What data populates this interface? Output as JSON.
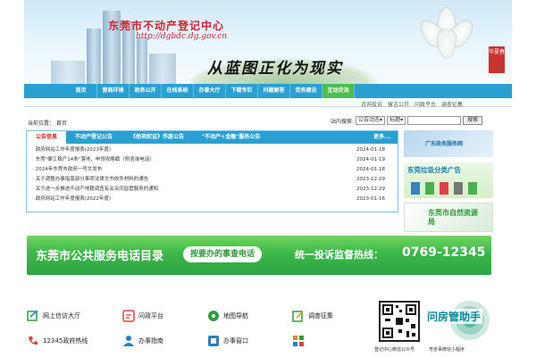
{
  "header": {
    "site_title": "东莞市不动产登记中心",
    "site_url": "http://dgbdc.dg.gov.cn",
    "slogan": "从蓝图正化为现实",
    "seal_text": "华夏春"
  },
  "nav": {
    "items": [
      "首页",
      "营商环境",
      "政务公开",
      "在线系统",
      "办事大厅",
      "下载专栏",
      "问题解答",
      "党务建设",
      "互动交流"
    ]
  },
  "subnav": {
    "links": [
      "咨询投诉",
      "留言公开",
      "问政平台",
      "调查征集"
    ]
  },
  "location": {
    "label": "当前位置：",
    "value": "首页"
  },
  "site_search": {
    "label": "站内搜索:",
    "scope_select": "公告动态",
    "field_select": "标题",
    "button": "搜索"
  },
  "announcements": {
    "tabs": [
      "公告信息",
      "不动产登记公告",
      "《他项权证》作废公告",
      "\"不动产+金融\"服务公告"
    ],
    "more": "更多...",
    "rows": [
      {
        "title": "政府网站工作年度报表(2023年度)",
        "date": "2024-01-18"
      },
      {
        "title": "东莞\"硬工稳产14条\"落地，申领攻略戳（附咨询电话）",
        "date": "2024-01-19"
      },
      {
        "title": "2024年东莞市政府一号文发布",
        "date": "2024-01-18"
      },
      {
        "title": "关于调整办事指南部分事项法律文书依件材料的通告",
        "date": "2023-12-29"
      },
      {
        "title": "关于进一步推进不动产地籍调查有关合同监管服务的通知",
        "date": "2023-12-29"
      },
      {
        "title": "政府网站工作年度报表(2022年度)",
        "date": "2023-01-16"
      }
    ]
  },
  "side_banners": {
    "gov_service": "广东政务服务网",
    "garbage": "东莞垃圾分类广告",
    "resource": "东莞市自然资源局"
  },
  "hotline": {
    "directory": "东莞市公共服务电话目录",
    "tag": "按要办的事查电话",
    "complaint_label": "统一投诉监督热线：",
    "number": "0769-12345"
  },
  "quick_links": {
    "row1": [
      "网上信访大厅",
      "问政平台",
      "地图导航",
      "调查征集"
    ],
    "row2": [
      "12345政府热线",
      "办事指南",
      "办事窗口"
    ]
  },
  "qr": {
    "wechat_label": "登记中心微信公众号",
    "mini_title": "问房管助手",
    "mini_label": "粤省事微信小程序"
  },
  "colors": {
    "nav_blue": "#2a9fd2",
    "title_red": "#d4202f",
    "hotline_green": "#3cb84a"
  }
}
